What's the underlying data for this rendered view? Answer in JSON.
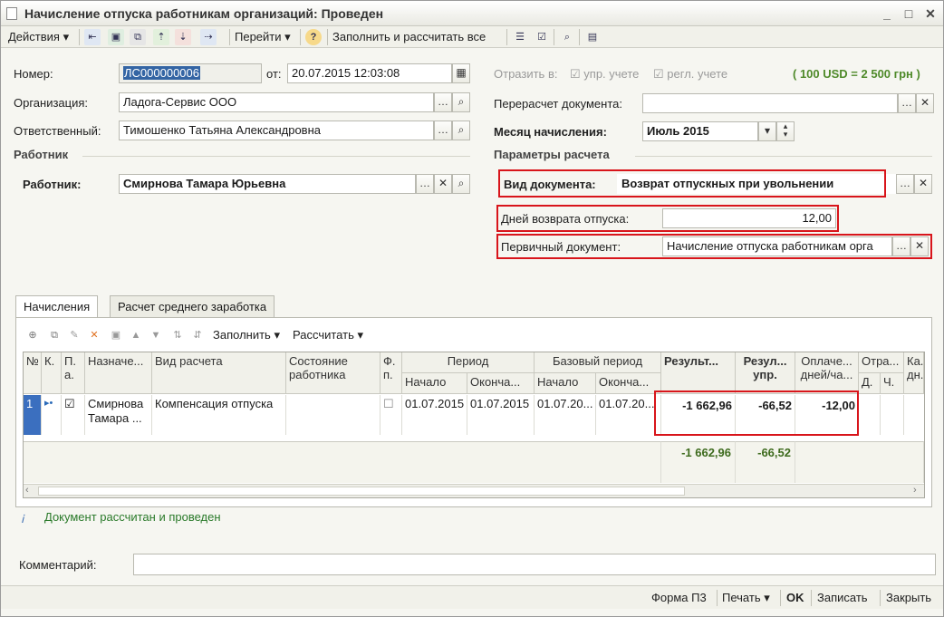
{
  "window": {
    "title": "Начисление отпуска работникам организаций: Проведен",
    "minimize": "_",
    "maximize": "□",
    "close": "✕"
  },
  "toolbar": {
    "actions": "Действия",
    "goto": "Перейти",
    "fill_calc": "Заполнить и рассчитать все"
  },
  "form": {
    "number_label": "Номер:",
    "number_value": "ЛС000000006",
    "date_label": "от:",
    "date_value": "20.07.2015 12:03:08",
    "org_label": "Организация:",
    "org_value": "Ладога-Сервис ООО",
    "resp_label": "Ответственный:",
    "resp_value": "Тимошенко Татьяна Александровна",
    "reflect_label": "Отразить в:",
    "upr_label": "упр. учете",
    "regl_label": "регл. учете",
    "rate": "( 100 USD = 2 500 грн )",
    "recalc_label": "Перерасчет документа:",
    "recalc_value": "",
    "month_label": "Месяц начисления:",
    "month_value": "Июль 2015",
    "worker_section": "Работник",
    "worker_label": "Работник:",
    "worker_value": "Смирнова Тамара Юрьевна",
    "params_section": "Параметры расчета",
    "doctype_label": "Вид документа:",
    "doctype_value": "Возврат отпускных при увольнении",
    "days_label": "Дней возврата отпуска:",
    "days_value": "12,00",
    "primary_label": "Первичный документ:",
    "primary_value": "Начисление отпуска работникам орга"
  },
  "tabs": {
    "accruals": "Начисления",
    "avg": "Расчет среднего заработка"
  },
  "grid_toolbar": {
    "fill": "Заполнить",
    "calc": "Рассчитать"
  },
  "grid": {
    "headers": {
      "no": "№",
      "k": "К.",
      "p": "П. а.",
      "assign": "Назначе...",
      "calc_type": "Вид расчета",
      "state": "Состояние работника",
      "f": "Ф. п.",
      "period": "Период",
      "start": "Начало",
      "end": "Оконча...",
      "base_period": "Базовый период",
      "base_start": "Начало",
      "base_end": "Оконча...",
      "result": "Результ...",
      "result_upr_1": "Резул...",
      "result_upr_2": "упр.",
      "paid_1": "Оплаче...",
      "paid_2": "дней/ча...",
      "otr": "Отра...",
      "d": "Д.",
      "ch": "Ч.",
      "ka_1": "Ка.",
      "ka_2": "дн."
    },
    "row": {
      "no": "1",
      "assign": "Смирнова Тамара ...",
      "calc_type": "Компенсация отпуска",
      "start": "01.07.2015",
      "end": "01.07.2015",
      "base_start": "01.07.20...",
      "base_end": "01.07.20...",
      "result": "-1 662,96",
      "result_upr": "-66,52",
      "paid": "-12,00"
    },
    "totals": {
      "result": "-1 662,96",
      "result_upr": "-66,52"
    }
  },
  "info": "Документ рассчитан и проведен",
  "comment_label": "Комментарий:",
  "comment_value": "",
  "bottom": {
    "form_p3": "Форма П3",
    "print": "Печать",
    "ok": "OK",
    "save": "Записать",
    "close": "Закрыть"
  },
  "colors": {
    "highlight": "#d8151b",
    "info_text": "#2a7a2a",
    "totals_text": "#3e6b1e"
  }
}
